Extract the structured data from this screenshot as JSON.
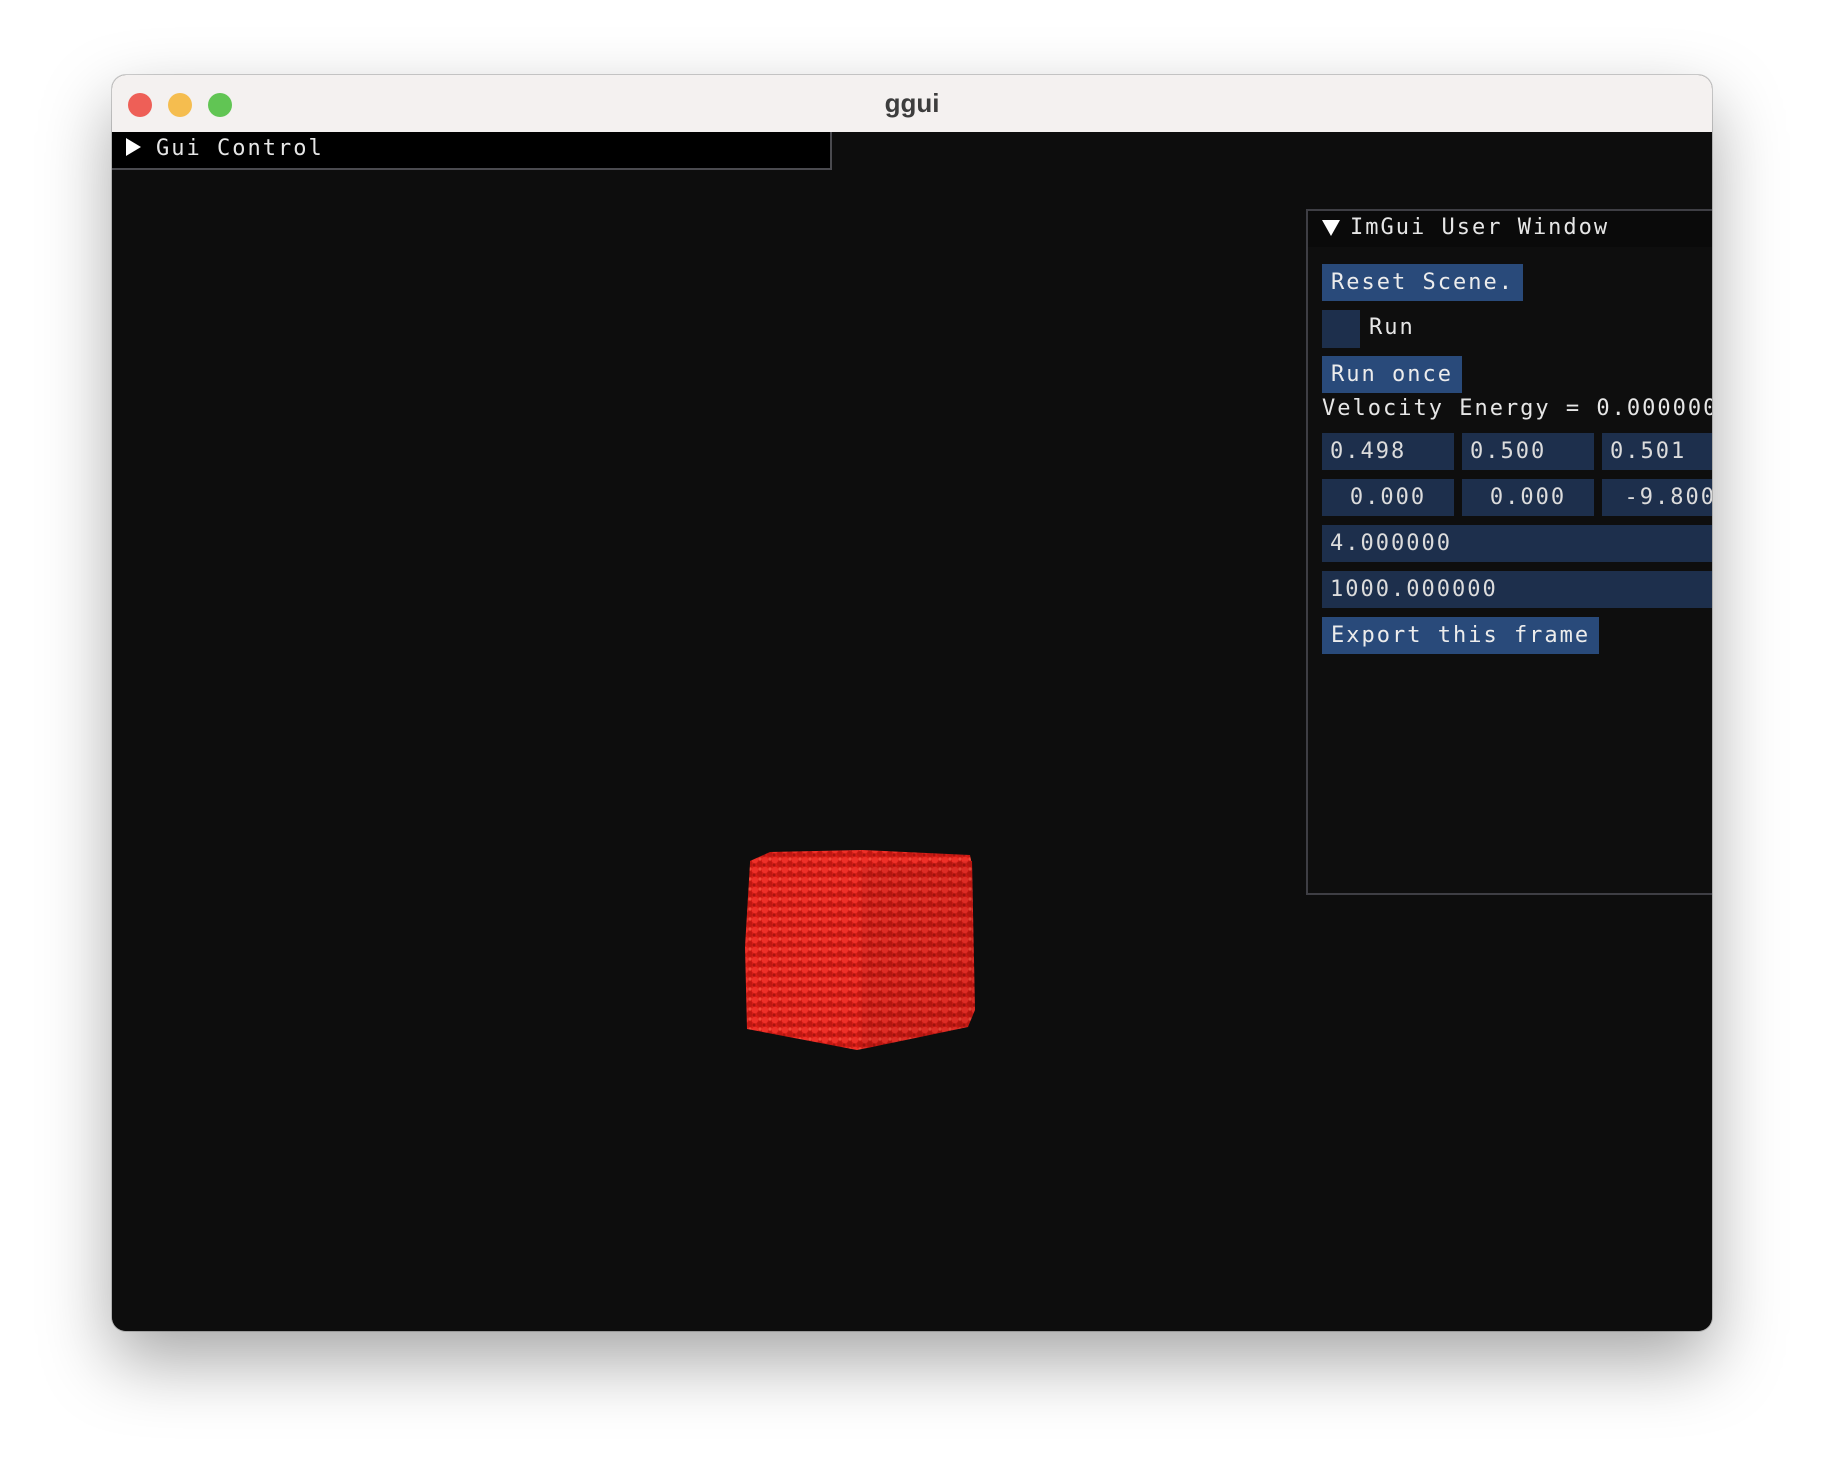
{
  "window": {
    "title": "ggui",
    "traffic_colors": {
      "close": "#ee5f57",
      "minimize": "#f5bd4f",
      "maximize": "#61c554"
    }
  },
  "gui_control": {
    "title": "Gui Control",
    "state": "collapsed"
  },
  "user_window": {
    "title": "ImGui User Window",
    "state": "expanded",
    "reset_button": "Reset Scene.",
    "run_checkbox": {
      "label": "Run",
      "checked": false
    },
    "run_once_button": "Run once",
    "velocity_energy_text": "Velocity Energy = 0.000000,",
    "row1": [
      "0.498",
      "0.500",
      "0.501"
    ],
    "row2": [
      "0.000",
      "0.000",
      "-9.800"
    ],
    "field3": "4.000000",
    "field4": "1000.000000",
    "export_button": "Export this frame"
  },
  "scene": {
    "object": "particle cube",
    "particle_color": "#e0201a"
  }
}
